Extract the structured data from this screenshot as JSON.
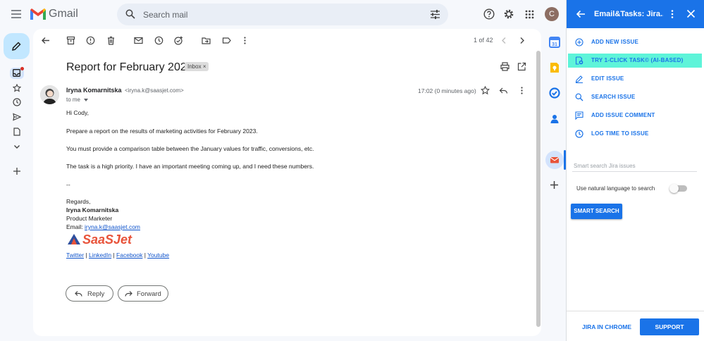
{
  "topbar": {
    "brand": "Gmail",
    "search_placeholder": "Search mail",
    "avatar_letter": "C"
  },
  "toolbar": {
    "pager": "1 of 42"
  },
  "email": {
    "subject": "Report for February 2023",
    "label": "Inbox",
    "label_close": "×",
    "sender_name": "Iryna Komarnitska",
    "sender_email": "<iryna.k@saasjet.com>",
    "recipient": "to me",
    "time": "17:02 (0 minutes ago)",
    "body": [
      "Hi Cody,",
      "Prepare a report on the results of marketing activities for February 2023.",
      "You must provide a comparison table between the January values for traffic, conversions, etc.",
      "The task is a high priority. I have an important meeting coming up, and I need these numbers.",
      "--"
    ],
    "signature": {
      "regards": "Regards,",
      "name": "Iryna Komarnitska",
      "role": "Product Marketer",
      "email_label": "Email: ",
      "email": "iryna.k@saasjet.com",
      "logo_text": "SaaSJet",
      "links": [
        "Twitter",
        "LinkedIn",
        "Facebook",
        "Youtube"
      ],
      "separator": " | "
    },
    "reply_label": "Reply",
    "forward_label": "Forward"
  },
  "panel": {
    "title": "Email&Tasks: Jira...",
    "items": [
      {
        "label": "ADD NEW ISSUE",
        "icon": "plus-circle-icon"
      },
      {
        "label": "TRY 1-CLICK TASK© (AI-BASED)",
        "icon": "ai-task-icon"
      },
      {
        "label": "EDIT ISSUE",
        "icon": "pencil-icon"
      },
      {
        "label": "SEARCH ISSUE",
        "icon": "search-icon"
      },
      {
        "label": "ADD ISSUE COMMENT",
        "icon": "comment-icon"
      },
      {
        "label": "LOG TIME TO ISSUE",
        "icon": "clock-icon"
      }
    ],
    "smart_search_placeholder": "Smart search Jira issues",
    "natural_language_label": "Use natural language to search",
    "natural_language_enabled": false,
    "smart_search_button": "SMART SEARCH",
    "jira_in_chrome": "JIRA IN CHROME",
    "support": "SUPPORT"
  },
  "colors": {
    "accent": "#1a73e8",
    "highlight": "#5ef4d9",
    "brand_red": "#e8533a"
  }
}
